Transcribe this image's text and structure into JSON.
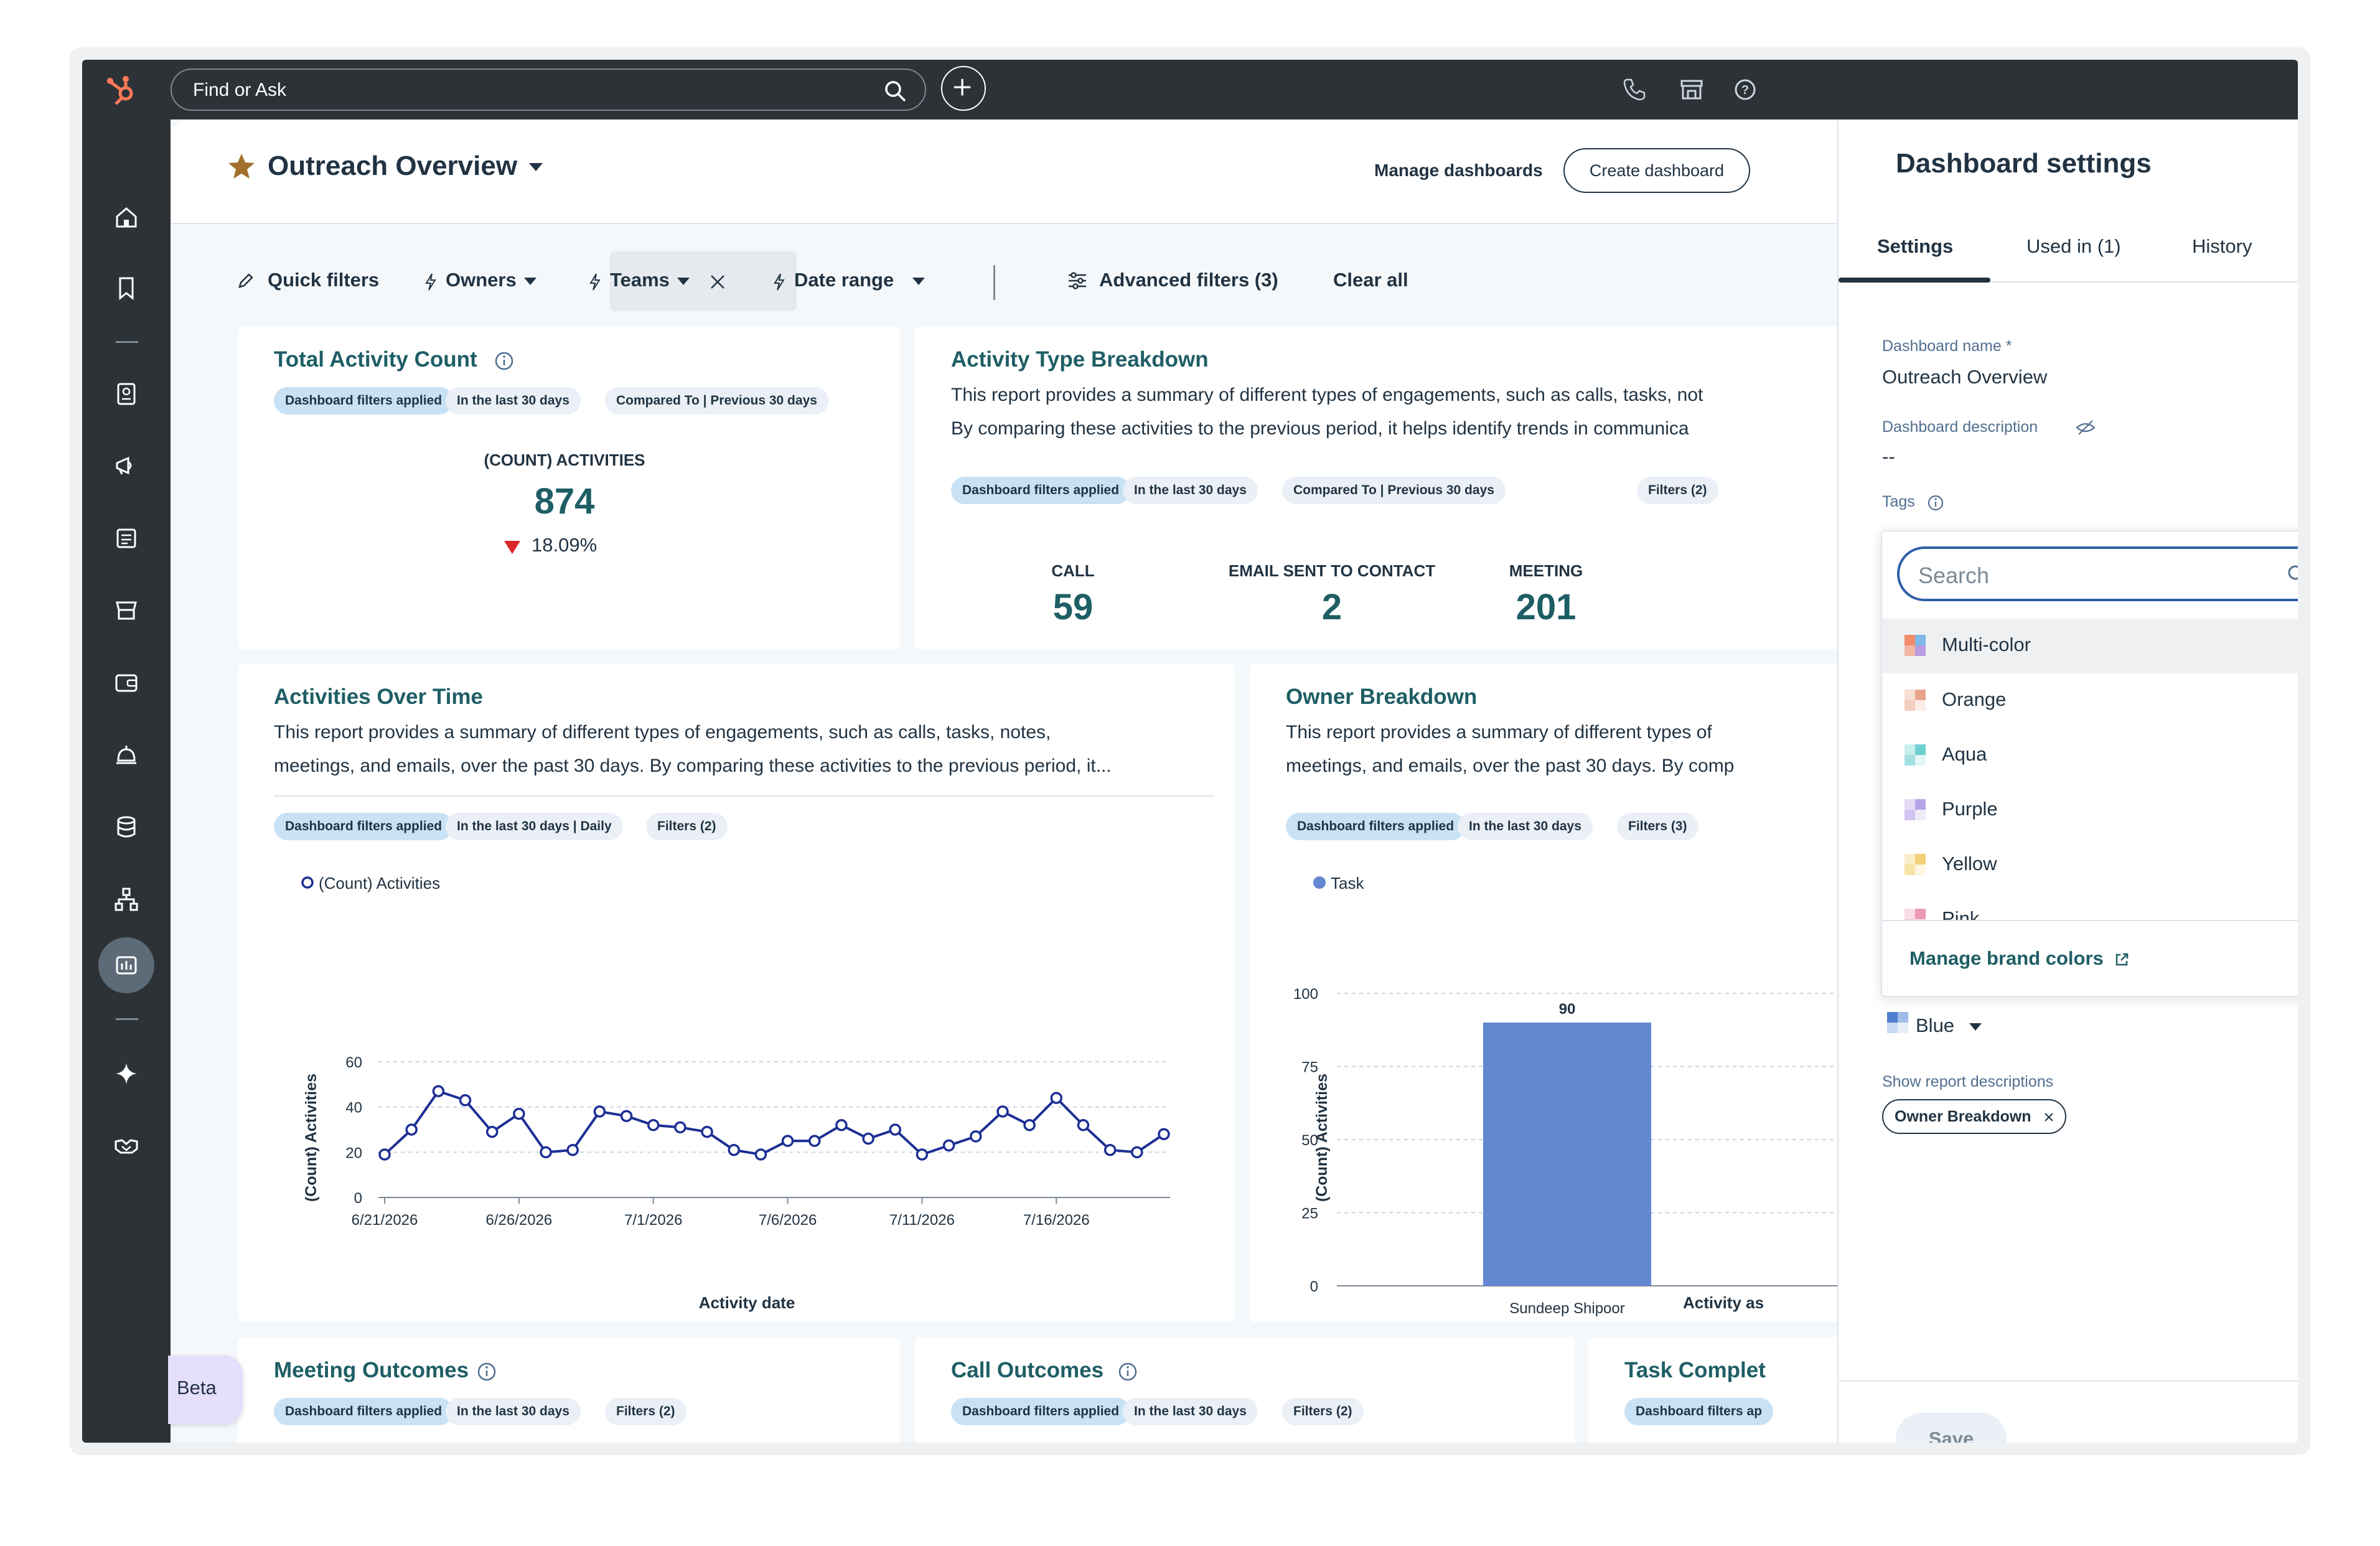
{
  "topbar": {
    "search_placeholder": "Find or Ask"
  },
  "header": {
    "title": "Outreach Overview",
    "manage_dashboards": "Manage dashboards",
    "create_dashboard": "Create dashboard"
  },
  "filters": {
    "quick": "Quick filters",
    "owners": "Owners",
    "teams": "Teams",
    "date_range": "Date range",
    "advanced": "Advanced filters (3)",
    "clear_all": "Clear all"
  },
  "cards": {
    "total": {
      "title": "Total Activity Count",
      "pills": [
        "Dashboard filters applied",
        "In the last 30 days",
        "Compared To | Previous 30 days"
      ],
      "metric_label": "(COUNT) ACTIVITIES",
      "value": "874",
      "change": "18.09%"
    },
    "breakdown": {
      "title": "Activity Type Breakdown",
      "desc1": "This report provides a summary of different types of engagements, such as calls, tasks, not",
      "desc2": "By comparing these activities to the previous period, it helps identify trends in communica",
      "pills": [
        "Dashboard filters applied",
        "In the last 30 days",
        "Compared To | Previous 30 days",
        "Filters (2)"
      ],
      "metrics": [
        {
          "label": "CALL",
          "value": "59"
        },
        {
          "label": "EMAIL SENT TO CONTACT",
          "value": "2"
        },
        {
          "label": "MEETING",
          "value": "201"
        }
      ]
    },
    "over_time": {
      "title": "Activities Over Time",
      "desc1": "This report provides a summary of different types of engagements, such as calls, tasks, notes,",
      "desc2": "meetings, and emails, over the past 30 days. By comparing these activities to the previous period, it...",
      "pills": [
        "Dashboard filters applied",
        "In the last 30 days | Daily",
        "Filters (2)"
      ]
    },
    "owner": {
      "title": "Owner Breakdown",
      "desc1": "This report provides a summary of different types of",
      "desc2": "meetings, and emails, over the past 30 days. By comp",
      "pills": [
        "Dashboard filters applied",
        "In the last 30 days",
        "Filters (3)"
      ]
    },
    "meeting": {
      "title": "Meeting Outcomes",
      "pills": [
        "Dashboard filters applied",
        "In the last 30 days",
        "Filters (2)"
      ]
    },
    "call": {
      "title": "Call Outcomes",
      "pills": [
        "Dashboard filters applied",
        "In the last 30 days",
        "Filters (2)"
      ]
    },
    "task": {
      "title": "Task Complet",
      "pills": [
        "Dashboard filters ap"
      ]
    }
  },
  "chart_data": [
    {
      "type": "line",
      "legend": "(Count) Activities",
      "ylabel": "(Count) Activities",
      "xlabel": "Activity date",
      "ylim": [
        0,
        60
      ],
      "yticks": [
        0,
        20,
        40,
        60
      ],
      "xticks": [
        "6/21/2026",
        "6/26/2026",
        "7/1/2026",
        "7/6/2026",
        "7/11/2026",
        "7/16/2026"
      ],
      "grid": true,
      "series": [
        {
          "name": "(Count) Activities",
          "values": [
            19,
            30,
            47,
            43,
            29,
            37,
            20,
            21,
            38,
            36,
            32,
            31,
            29,
            21,
            19,
            25,
            25,
            32,
            26,
            30,
            19,
            23,
            27,
            38,
            32,
            44,
            32,
            21,
            20,
            28
          ]
        }
      ]
    },
    {
      "type": "bar",
      "legend": "Task",
      "ylabel": "(Count) Activities",
      "xlabel": "Activity as",
      "ylim": [
        0,
        100
      ],
      "yticks": [
        0,
        25,
        50,
        75,
        100
      ],
      "grid": true,
      "categories": [
        "Sundeep Shipoor"
      ],
      "series": [
        {
          "name": "Task",
          "values": [
            90
          ]
        }
      ],
      "data_labels": [
        "90"
      ]
    }
  ],
  "panel": {
    "title": "Dashboard settings",
    "tabs": [
      "Settings",
      "Used in (1)",
      "History"
    ],
    "name_label": "Dashboard name *",
    "name_value": "Outreach Overview",
    "desc_label": "Dashboard description",
    "desc_value": "--",
    "tags_label": "Tags",
    "color_value": "Blue",
    "show_desc_label": "Show report descriptions",
    "show_desc_chip": "Owner Breakdown",
    "save": "Save"
  },
  "dropdown": {
    "placeholder": "Search",
    "items": [
      "Multi-color",
      "Orange",
      "Aqua",
      "Purple",
      "Yellow",
      "Pink"
    ],
    "manage_brand": "Manage brand colors"
  },
  "beta": "Beta",
  "colors": {
    "accent_teal": "#1e5e65",
    "line_navy": "#1d2f94",
    "bar_blue": "#6487d2",
    "dark_nav": "#2d3236",
    "focus_blue": "#2f5fa8",
    "down_red": "#d9262b"
  }
}
